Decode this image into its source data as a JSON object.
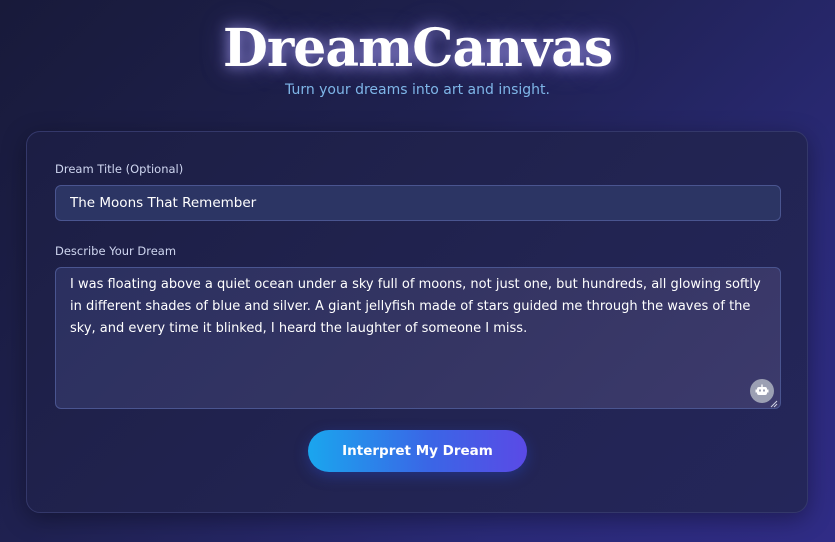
{
  "header": {
    "title": "DreamCanvas",
    "subtitle": "Turn your dreams into art and insight."
  },
  "form": {
    "title_label": "Dream Title (Optional)",
    "title_value": "The Moons That Remember",
    "description_label": "Describe Your Dream",
    "description_value": "I was floating above a quiet ocean under a sky full of moons, not just one, but hundreds, all glowing softly in different shades of blue and silver. A giant jellyfish made of stars guided me through the waves of the sky, and every time it blinked, I heard the laughter of someone I miss.",
    "assist_icon": "robot-icon",
    "submit_label": "Interpret My Dream"
  },
  "colors": {
    "background_start": "#181a3a",
    "background_end": "#302c86",
    "accent_start": "#1aa6ee",
    "accent_end": "#5a4ae6",
    "subtitle": "#7fb6e8"
  }
}
